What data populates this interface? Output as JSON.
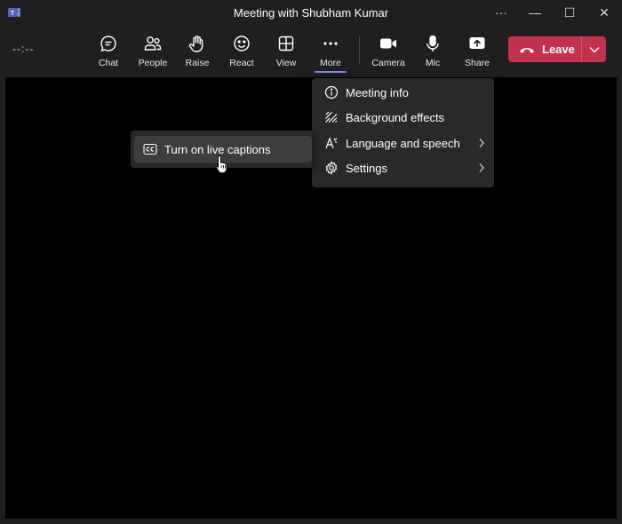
{
  "window": {
    "title": "Meeting with Shubham Kumar",
    "more_glyph": "···",
    "minimize_glyph": "—",
    "maximize_glyph": "☐",
    "close_glyph": "✕"
  },
  "toolbar": {
    "timer": "--:--",
    "buttons": [
      {
        "label": "Chat",
        "icon": "chat-icon"
      },
      {
        "label": "People",
        "icon": "people-icon"
      },
      {
        "label": "Raise",
        "icon": "hand-icon"
      },
      {
        "label": "React",
        "icon": "smiley-icon"
      },
      {
        "label": "View",
        "icon": "grid-icon"
      },
      {
        "label": "More",
        "icon": "ellipsis-icon",
        "active": true
      },
      {
        "label": "Camera",
        "icon": "camera-icon"
      },
      {
        "label": "Mic",
        "icon": "mic-icon"
      },
      {
        "label": "Share",
        "icon": "share-icon"
      }
    ],
    "leave_label": "Leave"
  },
  "more_menu": {
    "items": [
      {
        "label": "Meeting info",
        "icon": "info-icon"
      },
      {
        "label": "Background effects",
        "icon": "background-effects-icon"
      },
      {
        "label": "Language and speech",
        "icon": "language-icon",
        "has_submenu": true
      },
      {
        "label": "Settings",
        "icon": "gear-icon",
        "has_submenu": true
      }
    ]
  },
  "submenu": {
    "item_label": "Turn on live captions",
    "icon": "cc-icon"
  },
  "colors": {
    "background": "#1f1f1f",
    "stage": "#000000",
    "menu": "#292929",
    "leave_red": "#c4314b",
    "accent": "#7f85f5"
  }
}
